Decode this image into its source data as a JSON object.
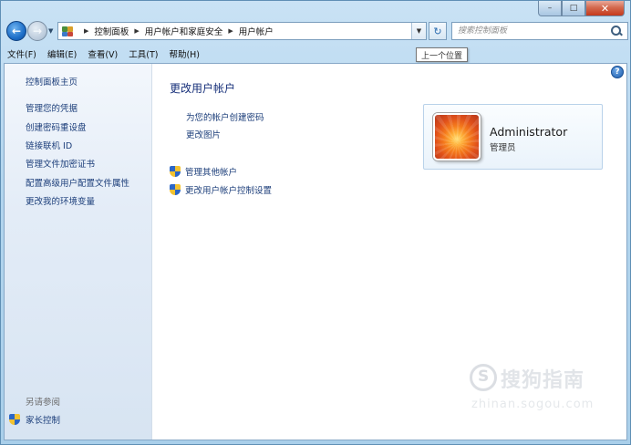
{
  "window": {
    "minimize_label": "–",
    "maximize_label": "□",
    "close_label": "✕"
  },
  "nav": {
    "back_glyph": "←",
    "forward_glyph": "→",
    "recent_glyph": "▼",
    "breadcrumbs": [
      "控制面板",
      "用户帐户和家庭安全",
      "用户帐户"
    ],
    "crumb_separator": "▶",
    "dropdown_glyph": "▼",
    "refresh_glyph": "↻",
    "search_placeholder": "搜索控制面板"
  },
  "menu": {
    "items": [
      "文件(F)",
      "编辑(E)",
      "查看(V)",
      "工具(T)",
      "帮助(H)"
    ]
  },
  "tooltip": "上一个位置",
  "sidebar": {
    "home": "控制面板主页",
    "links": [
      "管理您的凭据",
      "创建密码重设盘",
      "链接联机 ID",
      "管理文件加密证书",
      "配置高级用户配置文件属性",
      "更改我的环境变量"
    ],
    "see_also": "另请参阅",
    "family_safety": "家长控制"
  },
  "main": {
    "title": "更改用户帐户",
    "tasks": [
      "为您的帐户创建密码",
      "更改图片"
    ],
    "shield_tasks": [
      "管理其他帐户",
      "更改用户帐户控制设置"
    ],
    "help_glyph": "?"
  },
  "user": {
    "name": "Administrator",
    "role": "管理员"
  },
  "watermark": {
    "text": "搜狗指南",
    "url": "zhinan.sogou.com"
  }
}
